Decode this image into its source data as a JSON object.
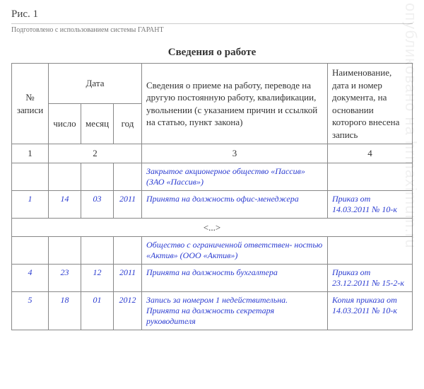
{
  "watermark": "опубликовано на hrmaximum.ru",
  "figure_label": "Рис. 1",
  "source_note": "Подготовлено с использованием системы ГАРАНТ",
  "title": "Сведения о работе",
  "headers": {
    "col_no": "№ записи",
    "col_date": "Дата",
    "col_day": "число",
    "col_month": "месяц",
    "col_year": "год",
    "col_info": "Сведения о приеме на работу, переводе на другую постоянную работу, квалификации, увольнении (с указанием причин и ссылкой на статью, пункт закона)",
    "col_doc": "Наименование, дата и номер документа, на основании которого внесена запись",
    "nums": {
      "c1": "1",
      "c2": "2",
      "c3": "3",
      "c4": "4"
    }
  },
  "rows": [
    {
      "no": "",
      "day": "",
      "month": "",
      "year": "",
      "info": "Закрытое акционерное общество «Пассив» (ЗАО «Пассив»)",
      "doc": ""
    },
    {
      "no": "1",
      "day": "14",
      "month": "03",
      "year": "2011",
      "info": "Принята на должность офис-менеджера",
      "doc": "Приказ от 14.03.2011 № 10-к"
    },
    {
      "type": "ellipsis",
      "text": "<...>"
    },
    {
      "no": "",
      "day": "",
      "month": "",
      "year": "",
      "info": "Общество с ограниченной ответствен- ностью «Актив» (ООО «Актив»)",
      "doc": ""
    },
    {
      "no": "4",
      "day": "23",
      "month": "12",
      "year": "2011",
      "info": "Принята на должность бухгалтера",
      "doc": "Приказ от 23.12.2011 № 15-2-к"
    },
    {
      "no": "5",
      "day": "18",
      "month": "01",
      "year": "2012",
      "info": "Запись за номером 1 недействительна. Принята на должность секретаря руководителя",
      "doc": "Копия приказа от 14.03.2011 № 10-к"
    }
  ]
}
